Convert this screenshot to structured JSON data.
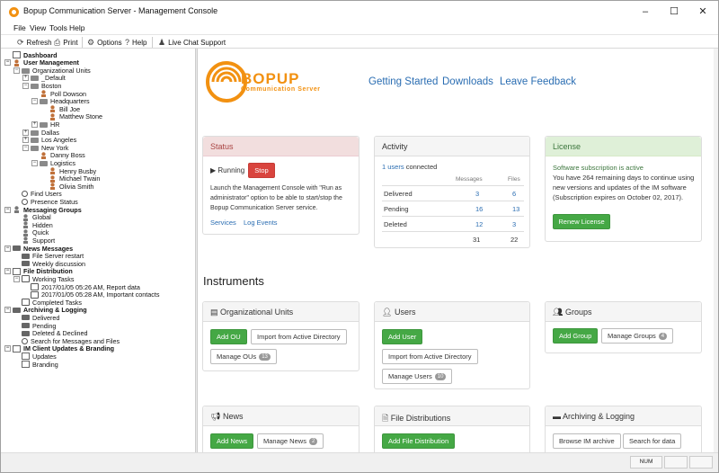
{
  "window": {
    "title": "Bopup Communication Server - Management Console",
    "controls": {
      "minimize": "–",
      "maximize": "☐",
      "close": "✕"
    }
  },
  "menu": [
    "File",
    "View",
    "Tools",
    "Help"
  ],
  "toolbar": {
    "refresh": "Refresh",
    "print": "Print",
    "options": "Options",
    "help": "Help",
    "live_chat": "Live Chat Support"
  },
  "tree": [
    {
      "label": "Dashboard",
      "level": 0,
      "bold": true,
      "icon": "doc",
      "expander": ""
    },
    {
      "label": "User Management",
      "level": 0,
      "bold": true,
      "icon": "user",
      "expander": "−"
    },
    {
      "label": "Organizational Units",
      "level": 1,
      "bold": false,
      "icon": "folder",
      "expander": "−"
    },
    {
      "label": "_Default",
      "level": 2,
      "bold": false,
      "icon": "folder",
      "expander": "+"
    },
    {
      "label": "Boston",
      "level": 2,
      "bold": false,
      "icon": "folder",
      "expander": "−"
    },
    {
      "label": "Poll Dowson",
      "level": 3,
      "bold": false,
      "icon": "user",
      "expander": ""
    },
    {
      "label": "Headquarters",
      "level": 3,
      "bold": false,
      "icon": "folder",
      "expander": "−"
    },
    {
      "label": "Bill Joe",
      "level": 4,
      "bold": false,
      "icon": "user",
      "expander": ""
    },
    {
      "label": "Matthew Stone",
      "level": 4,
      "bold": false,
      "icon": "user",
      "expander": ""
    },
    {
      "label": "HR",
      "level": 3,
      "bold": false,
      "icon": "folder",
      "expander": "+"
    },
    {
      "label": "Dallas",
      "level": 2,
      "bold": false,
      "icon": "folder",
      "expander": "+"
    },
    {
      "label": "Los Angeles",
      "level": 2,
      "bold": false,
      "icon": "folder",
      "expander": "+"
    },
    {
      "label": "New York",
      "level": 2,
      "bold": false,
      "icon": "folder",
      "expander": "−"
    },
    {
      "label": "Danny Boss",
      "level": 3,
      "bold": false,
      "icon": "user",
      "expander": ""
    },
    {
      "label": "Logistics",
      "level": 3,
      "bold": false,
      "icon": "folder",
      "expander": "−"
    },
    {
      "label": "Henry Busby",
      "level": 4,
      "bold": false,
      "icon": "user",
      "expander": ""
    },
    {
      "label": "Michael Twain",
      "level": 4,
      "bold": false,
      "icon": "user",
      "expander": ""
    },
    {
      "label": "Olivia Smith",
      "level": 4,
      "bold": false,
      "icon": "user",
      "expander": ""
    },
    {
      "label": "Find Users",
      "level": 1,
      "bold": false,
      "icon": "search",
      "expander": ""
    },
    {
      "label": "Presence Status",
      "level": 1,
      "bold": false,
      "icon": "search",
      "expander": ""
    },
    {
      "label": "Messaging Groups",
      "level": 0,
      "bold": true,
      "icon": "grey",
      "expander": "−"
    },
    {
      "label": "Global",
      "level": 1,
      "bold": false,
      "icon": "grey",
      "expander": ""
    },
    {
      "label": "Hidden",
      "level": 1,
      "bold": false,
      "icon": "grey",
      "expander": ""
    },
    {
      "label": "Quick",
      "level": 1,
      "bold": false,
      "icon": "grey",
      "expander": ""
    },
    {
      "label": "Support",
      "level": 1,
      "bold": false,
      "icon": "grey",
      "expander": ""
    },
    {
      "label": "News Messages",
      "level": 0,
      "bold": true,
      "icon": "msg",
      "expander": "−"
    },
    {
      "label": "File Server restart",
      "level": 1,
      "bold": false,
      "icon": "msg",
      "expander": ""
    },
    {
      "label": "Weekly discussion",
      "level": 1,
      "bold": false,
      "icon": "msg",
      "expander": ""
    },
    {
      "label": "File Distribution",
      "level": 0,
      "bold": true,
      "icon": "doc",
      "expander": "−"
    },
    {
      "label": "Working Tasks",
      "level": 1,
      "bold": false,
      "icon": "task",
      "expander": "−"
    },
    {
      "label": "2017/01/05 05:26 AM, Report data",
      "level": 2,
      "bold": false,
      "icon": "task",
      "expander": ""
    },
    {
      "label": "2017/01/05 05:28 AM, Important contacts",
      "level": 2,
      "bold": false,
      "icon": "task",
      "expander": ""
    },
    {
      "label": "Completed Tasks",
      "level": 1,
      "bold": false,
      "icon": "task",
      "expander": ""
    },
    {
      "label": "Archiving & Logging",
      "level": 0,
      "bold": true,
      "icon": "msg",
      "expander": "−"
    },
    {
      "label": "Delivered",
      "level": 1,
      "bold": false,
      "icon": "msg",
      "expander": ""
    },
    {
      "label": "Pending",
      "level": 1,
      "bold": false,
      "icon": "msg",
      "expander": ""
    },
    {
      "label": "Deleted & Declined",
      "level": 1,
      "bold": false,
      "icon": "msg",
      "expander": ""
    },
    {
      "label": "Search for Messages and Files",
      "level": 1,
      "bold": false,
      "icon": "search",
      "expander": ""
    },
    {
      "label": "IM Client Updates & Branding",
      "level": 0,
      "bold": true,
      "icon": "doc",
      "expander": "−"
    },
    {
      "label": "Updates",
      "level": 1,
      "bold": false,
      "icon": "doc",
      "expander": ""
    },
    {
      "label": "Branding",
      "level": 1,
      "bold": false,
      "icon": "doc",
      "expander": ""
    }
  ],
  "header": {
    "logo_word": "BOPUP",
    "logo_sub": "Communication Server",
    "links": [
      "Getting Started",
      "Downloads",
      "Leave Feedback"
    ]
  },
  "status_panel": {
    "title": "Status",
    "state": "Running",
    "stop_label": "Stop",
    "note": "Launch the Management Console with \"Run as administrator\" option to be able to start/stop the Bopup Communication Server service.",
    "services_link": "Services",
    "log_link": "Log Events"
  },
  "activity_panel": {
    "title": "Activity",
    "users_link": "1 users",
    "users_suffix": "connected",
    "col_messages": "Messages",
    "col_files": "Files",
    "rows": [
      {
        "label": "Delivered",
        "messages": "3",
        "files": "6"
      },
      {
        "label": "Pending",
        "messages": "16",
        "files": "13"
      },
      {
        "label": "Deleted",
        "messages": "12",
        "files": "3"
      }
    ],
    "total_messages": "31",
    "total_files": "22"
  },
  "license_panel": {
    "title": "License",
    "active_text": "Software subscription is active",
    "detail": "You have 264 remaining days to continue using new versions and updates of the IM software (Subscription expires on October 02, 2017).",
    "renew_label": "Renew License"
  },
  "instruments": {
    "heading": "Instruments",
    "org_units": {
      "title": "Organizational Units",
      "add": "Add OU",
      "import": "Import from Active Directory",
      "manage": "Manage OUs",
      "count": "13"
    },
    "users": {
      "title": "Users",
      "add": "Add User",
      "import": "Import from Active Directory",
      "manage": "Manage Users",
      "count": "10"
    },
    "groups": {
      "title": "Groups",
      "add": "Add Group",
      "manage": "Manage Groups",
      "count": "4"
    },
    "news": {
      "title": "News",
      "add": "Add News",
      "manage": "Manage News",
      "count": "2"
    },
    "files": {
      "title": "File Distributions",
      "add": "Add File Distribution"
    },
    "archiving": {
      "title": "Archiving & Logging",
      "browse": "Browse IM archive",
      "search": "Search for data"
    }
  },
  "statusbar": {
    "num": "NUM"
  },
  "colors": {
    "accent_orange": "#f29111",
    "link_blue": "#2a6db2",
    "button_green": "#45a845",
    "stop_red": "#d9443e"
  }
}
